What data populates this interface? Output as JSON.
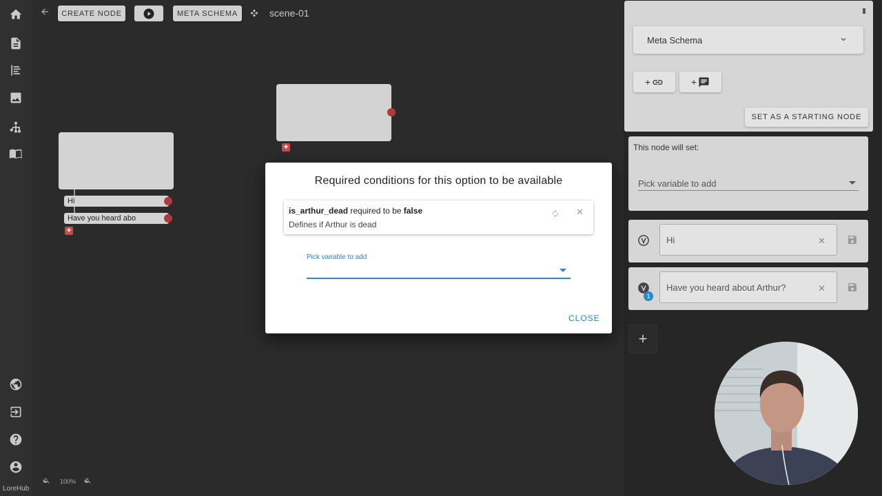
{
  "app": {
    "brand": "LoreHub"
  },
  "sidebar": {
    "items": [
      {
        "icon": "home-icon"
      },
      {
        "icon": "document-icon"
      },
      {
        "icon": "list-icon"
      },
      {
        "icon": "image-icon"
      },
      {
        "icon": "hierarchy-icon"
      },
      {
        "icon": "book-icon"
      },
      {
        "icon": "globe-icon"
      },
      {
        "icon": "logout-icon"
      },
      {
        "icon": "help-icon"
      },
      {
        "icon": "account-icon"
      }
    ]
  },
  "toolbar": {
    "create_node": "CREATE NODE",
    "meta_schema": "META SCHEMA",
    "scene_name": "scene-01"
  },
  "canvas": {
    "options": [
      "Hi",
      "Have you heard abo"
    ],
    "add_glyph": "+",
    "zoom_level": "100%"
  },
  "panel": {
    "schema_select": "Meta Schema",
    "add_link_glyph": "+",
    "add_comment_glyph": "+",
    "start_button": "SET AS A STARTING NODE",
    "sets_label": "This node will set:",
    "sets_placeholder": "Pick variable to add",
    "options": [
      {
        "text": "Hi",
        "badge": ""
      },
      {
        "text": "Have you heard about Arthur?",
        "badge": "1"
      }
    ],
    "add_option_glyph": "+"
  },
  "dialog": {
    "title": "Required conditions for this option to be available",
    "condition": {
      "variable": "is_arthur_dead",
      "middle": " required to be ",
      "value": "false",
      "description": "Defines if Arthur is dead"
    },
    "pick_label": "Pick variable to add",
    "close_label": "CLOSE"
  },
  "colors": {
    "accent": "#2a87c9",
    "connector": "#b03a3a",
    "canvas_bg": "#2b2b2b"
  }
}
